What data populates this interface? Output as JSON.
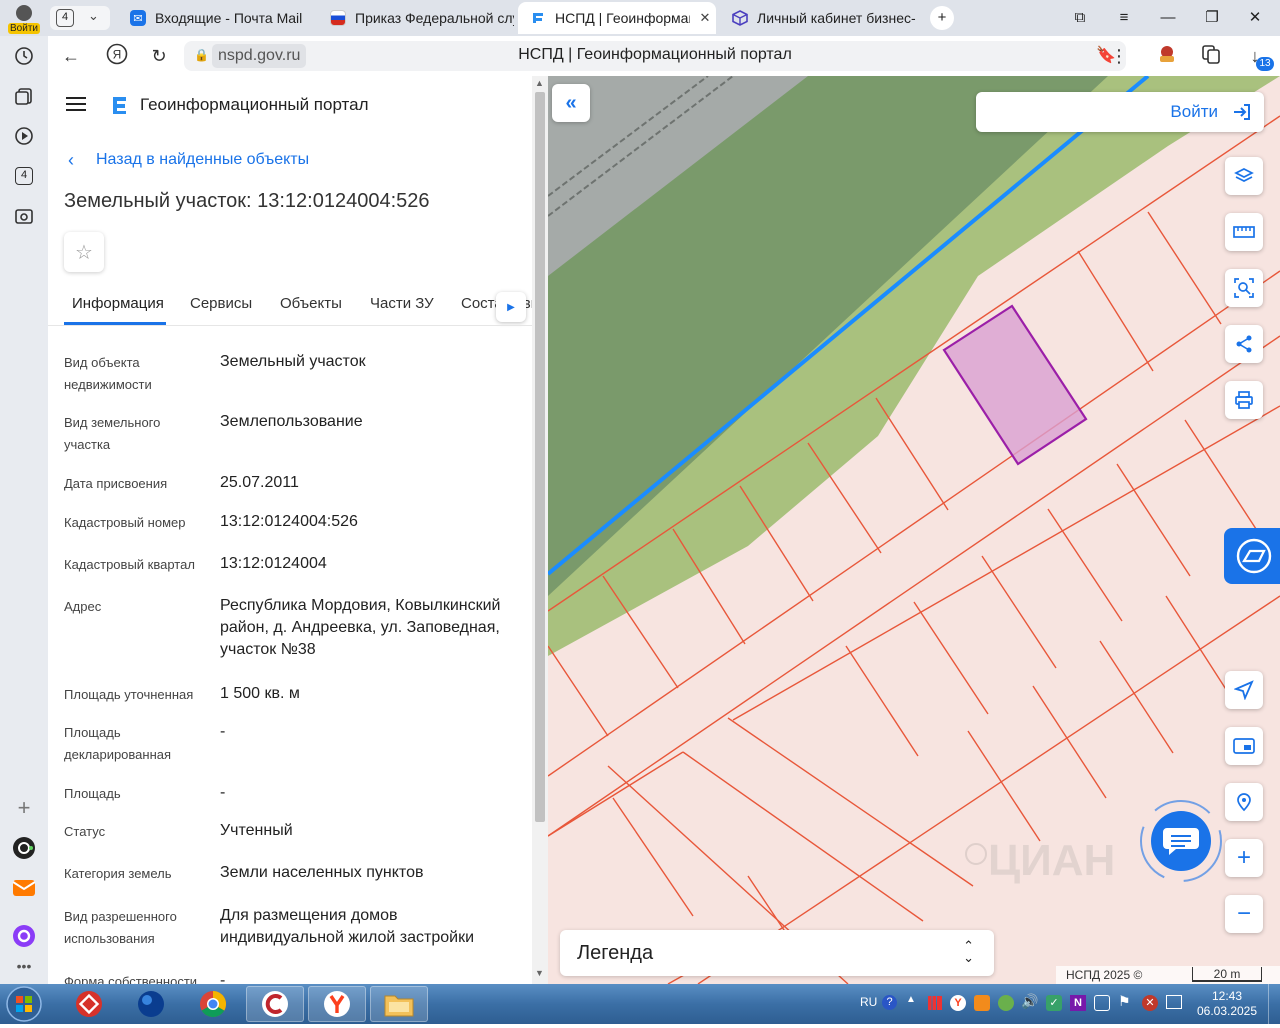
{
  "browser": {
    "profile_label": "Войти",
    "tab_count": "4",
    "tabs": [
      {
        "title": "Входящие - Почта Mail",
        "active": false
      },
      {
        "title": "Приказ Федеральной слу",
        "active": false
      },
      {
        "title": "НСПД | Геоинформаци",
        "active": true
      },
      {
        "title": "Личный кабинет бизнес-с",
        "active": false
      }
    ],
    "url": "nspd.gov.ru",
    "page_title": "НСПД | Геоинформационный портал",
    "downloads_badge": "13",
    "sidebar_badge": "4"
  },
  "portal": {
    "title": "Геоинформационный портал",
    "back_link": "Назад в найденные объекты",
    "object_title": "Земельный участок: 13:12:0124004:526",
    "tabs": [
      "Информация",
      "Сервисы",
      "Объекты",
      "Части ЗУ",
      "Соста",
      "вы"
    ],
    "fields": [
      {
        "label": "Вид объекта недвижимости",
        "value": "Земельный участок"
      },
      {
        "label": "Вид земельного участка",
        "value": "Землепользование"
      },
      {
        "label": "Дата присвоения",
        "value": "25.07.2011"
      },
      {
        "label": "Кадастровый номер",
        "value": "13:12:0124004:526"
      },
      {
        "label": "Кадастровый квартал",
        "value": "13:12:0124004"
      },
      {
        "label": "Адрес",
        "value": "Республика Мордовия, Ковылкинский район, д. Андреевка, ул. Заповедная, участок №38"
      },
      {
        "label": "Площадь уточненная",
        "value": "1 500 кв. м"
      },
      {
        "label": "Площадь декларированная",
        "value": "-"
      },
      {
        "label": "Площадь",
        "value": "-"
      },
      {
        "label": "Статус",
        "value": "Учтенный"
      },
      {
        "label": "Категория земель",
        "value": "Земли населенных пунктов"
      },
      {
        "label": "Вид разрешенного использования",
        "value": "Для размещения домов индивидуальной жилой застройки"
      },
      {
        "label": "Форма собственности",
        "value": "-"
      }
    ]
  },
  "map": {
    "login_label": "Войти",
    "legend_label": "Легенда",
    "copyright": "НСПД 2025 ©",
    "scale_label": "20 m",
    "watermark": "ЦИАН"
  },
  "taskbar": {
    "lang": "RU",
    "time": "12:43",
    "date": "06.03.2025"
  },
  "colors": {
    "accent": "#1a73e8",
    "parcel_line": "#e8573a",
    "selected_parcel": "#9b1fa8",
    "forest": "#7a9a6b",
    "meadow": "#a9c17e",
    "boundary": "#1a8cff"
  }
}
